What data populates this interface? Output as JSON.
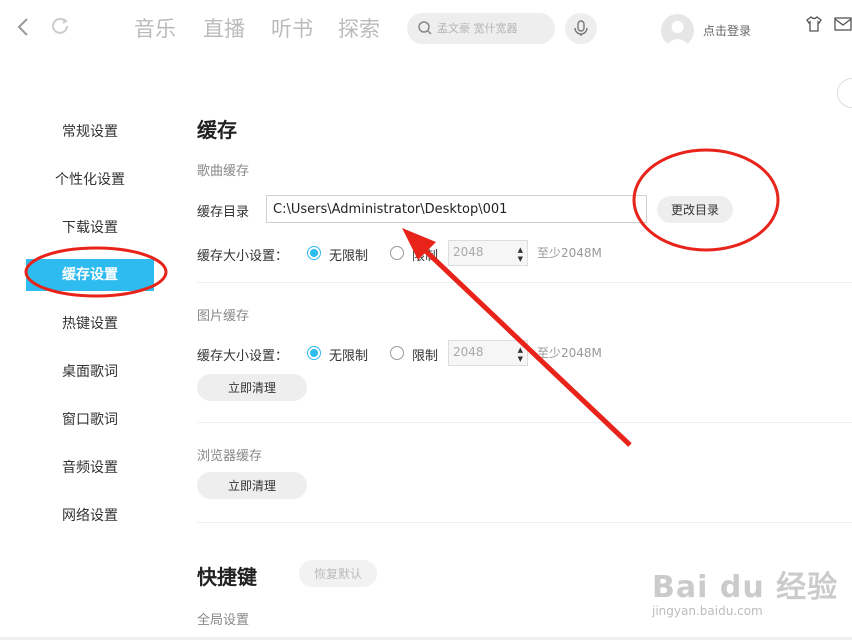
{
  "nav": {
    "tabs": [
      "音乐",
      "直播",
      "听书",
      "探索"
    ],
    "search_placeholder": "孟文豪 宽什宽器",
    "login_label": "点击登录"
  },
  "sidebar": {
    "items": [
      {
        "label": "常规设置",
        "active": false
      },
      {
        "label": "个性化设置",
        "active": false
      },
      {
        "label": "下载设置",
        "active": false
      },
      {
        "label": "缓存设置",
        "active": true
      },
      {
        "label": "热键设置",
        "active": false
      },
      {
        "label": "桌面歌词",
        "active": false
      },
      {
        "label": "窗口歌词",
        "active": false
      },
      {
        "label": "音频设置",
        "active": false
      },
      {
        "label": "网络设置",
        "active": false
      }
    ]
  },
  "cache": {
    "title": "缓存",
    "song_section": {
      "label": "歌曲缓存",
      "dir_label": "缓存目录",
      "dir_value": "C:\\Users\\Administrator\\Desktop\\001",
      "change_dir_button": "更改目录",
      "size_label": "缓存大小设置：",
      "unlimited_label": "无限制",
      "limit_label": "限制",
      "limit_value": "2048",
      "hint": "至少2048M",
      "selected": "unlimited"
    },
    "image_section": {
      "label": "图片缓存",
      "size_label": "缓存大小设置：",
      "unlimited_label": "无限制",
      "limit_label": "限制",
      "limit_value": "2048",
      "hint": "至少2048M",
      "clear_button": "立即清理",
      "selected": "unlimited"
    },
    "browser_section": {
      "label": "浏览器缓存",
      "clear_button": "立即清理"
    }
  },
  "shortcuts": {
    "title": "快捷键",
    "restore_button": "恢复默认",
    "global_label": "全局设置"
  },
  "watermark": {
    "brand": "Bai du 经验",
    "url": "jingyan.baidu.com"
  },
  "colors": {
    "accent": "#2ebbf0",
    "annotation": "#e8231a"
  }
}
